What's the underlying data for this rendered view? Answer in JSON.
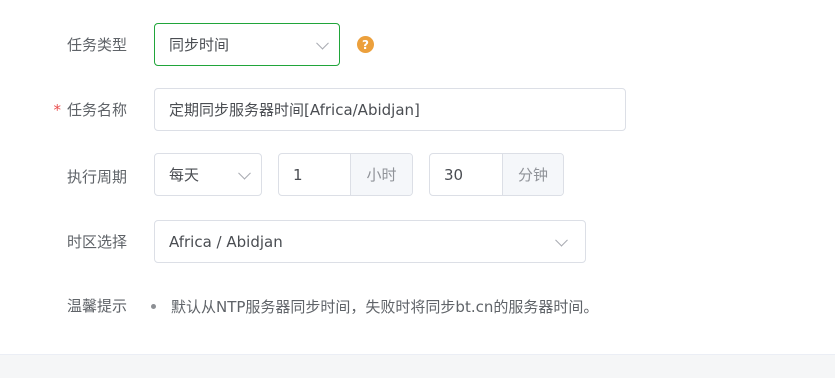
{
  "task_type": {
    "label": "任务类型",
    "value": "同步时间",
    "help_icon": "question-icon",
    "help_glyph": "?",
    "accent_color": "#20a53a",
    "help_color": "#eca03c"
  },
  "task_name": {
    "required_mark": "*",
    "label": "任务名称",
    "value": "定期同步服务器时间[Africa/Abidjan]"
  },
  "period": {
    "label": "执行周期",
    "frequency": "每天",
    "hour_value": "1",
    "hour_unit": "小时",
    "minute_value": "30",
    "minute_unit": "分钟"
  },
  "timezone": {
    "label": "时区选择",
    "value": "Africa / Abidjan"
  },
  "tip": {
    "label": "温馨提示",
    "text": "默认从NTP服务器同步时间，失败时将同步bt.cn的服务器时间。"
  }
}
